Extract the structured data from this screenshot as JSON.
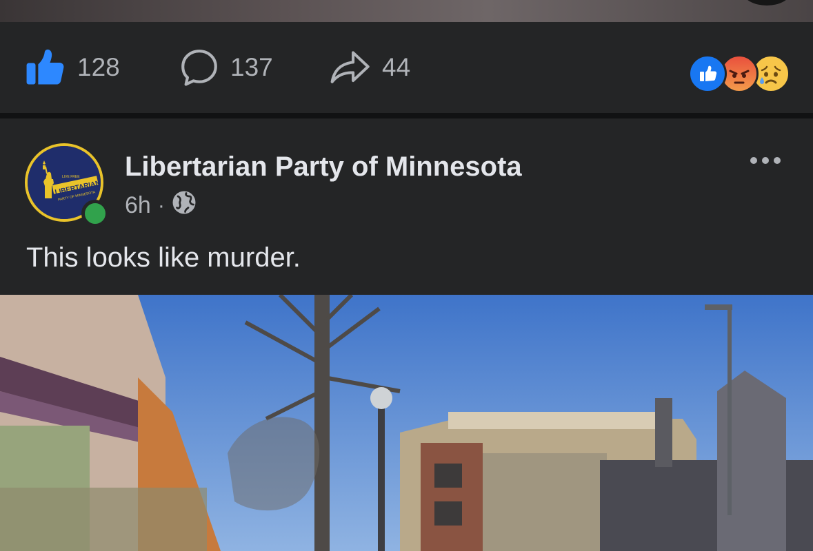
{
  "prev_post": {
    "like_count": "128",
    "comment_count": "137",
    "share_count": "44",
    "reactions": [
      "like-reaction",
      "angry-reaction",
      "sad-reaction"
    ]
  },
  "post": {
    "page_name": "Libertarian Party of Minnesota",
    "time": "6h",
    "separator": "·",
    "audience_icon": "globe-icon",
    "text": "This looks like murder.",
    "avatar": {
      "line1": "LIVE FREE",
      "line2": "LIBERTARIAN",
      "line3": "PARTY OF MINNESOTA"
    }
  },
  "colors": {
    "background": "#242526",
    "text_primary": "#e4e6eb",
    "text_secondary": "#b0b3b8",
    "like_blue": "#1877f2",
    "online_green": "#31a24c",
    "avatar_navy": "#1f2d6b",
    "avatar_gold": "#e9c32a"
  }
}
